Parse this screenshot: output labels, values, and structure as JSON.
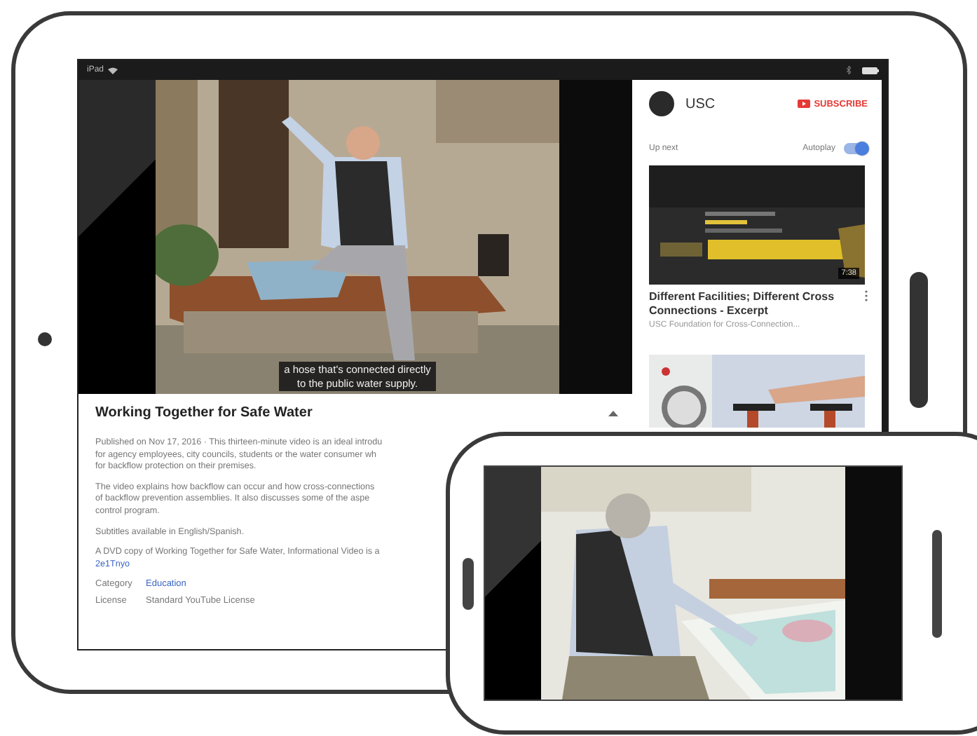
{
  "tablet": {
    "status_bar": {
      "device": "iPad"
    },
    "video": {
      "kind": "picture",
      "captions": [
        "a hose that's connected directly",
        "to the public water supply."
      ]
    },
    "info": {
      "title": "Working Together for Safe Water",
      "expanded": true,
      "paragraphs": [
        {
          "lines": [
            "Published on Nov 17, 2016 · This thirteen-minute video is an ideal introdu",
            "for agency employees, city councils, students or the water consumer wh",
            "for backflow protection on their premises."
          ]
        },
        {
          "lines": [
            "The video explains how backflow can occur and how cross-connections",
            "of backflow prevention assemblies. It also discusses some of the aspe",
            "control program."
          ]
        },
        {
          "lines": [
            "Subtitles available in English/Spanish."
          ]
        },
        {
          "lines": [
            "A DVD copy of Working Together for Safe Water, Informational Video is a"
          ],
          "link": "2e1Tnyo"
        }
      ],
      "meta": [
        {
          "label": "Category",
          "value": "Education",
          "link": true
        },
        {
          "label": "License",
          "value": "Standard YouTube License",
          "link": false
        }
      ]
    },
    "sidebar": {
      "channel": "USC",
      "subscribe": "SUBSCRIBE",
      "up_next": "Up next",
      "autoplay": {
        "label": "Autoplay",
        "on": true
      },
      "videos": [
        {
          "kind": "picture",
          "duration": "7:38",
          "title": "Different Facilities; Different Cross Connections - Excerpt",
          "channel": "USC Foundation for Cross-Connection..."
        },
        {
          "kind": "picture"
        }
      ]
    }
  },
  "phone": {
    "video": {
      "kind": "picture"
    }
  }
}
